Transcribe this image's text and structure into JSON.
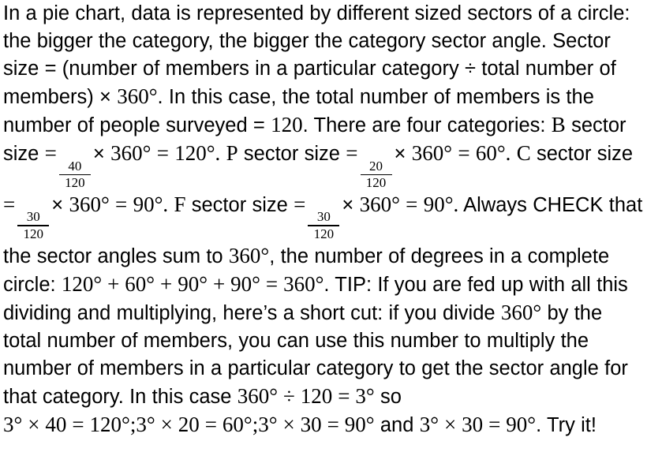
{
  "document": {
    "type": "textbook-explanation",
    "topic": "Pie chart sector size calculation",
    "body": {
      "s1": "In a pie chart, data is represented by different sized sectors of a circle: the bigger the category, the bigger the category sector angle. Sector size = (number of members in a particular category ÷ total number of members) × ",
      "deg360_a": "360°",
      "s2": ". In this case, the total number of members is the number of people surveyed = ",
      "n120_a": "120",
      "s3": ". There are four categories: ",
      "cat_b": "B",
      "s4": " sector size ",
      "eq1": "=",
      "frac1_num": "40",
      "frac1_den": "120",
      "times1": "×",
      "deg360_b": "360°",
      "eq2": "=",
      "deg120_a": "120°",
      "dot1": ".",
      "cat_p": "P",
      "s5": " sector size ",
      "eq3": "=",
      "frac2_num": "20",
      "frac2_den": "120",
      "times2": "×",
      "deg360_c": "360°",
      "eq4": "=",
      "deg60_a": "60°",
      "dot2": ".",
      "cat_c": "C",
      "s6": " sector size ",
      "eq5": "=",
      "frac3_num": "30",
      "frac3_den": "120",
      "times3": "×",
      "deg360_d": "360°",
      "eq6": "=",
      "deg90_a": "90°",
      "dot3": ".",
      "cat_f": "F",
      "s7": " sector size ",
      "eq7": "=",
      "frac4_num": "30",
      "frac4_den": "120",
      "times4": "×",
      "deg360_e": "360°",
      "eq8": "=",
      "deg90_b": "90°",
      "dot4": ".",
      "s8": " Always CHECK that the sector angles sum to ",
      "deg360_f": "360°",
      "s9": ", the number of degrees in a complete circle: ",
      "sum_expr": "120° + 60° + 90° + 90° = 360°",
      "s10": ". TIP: If you are fed up with all this dividing and multiplying, here’s a short cut: if you divide ",
      "deg360_g": "360°",
      "s11": " by the total number of members, you can use this number to multiply the number of members in a particular category to get the sector angle for that category. In this case ",
      "shortcut_1": "360° ÷ 120 = 3°",
      "s12": " so ",
      "shortcut_2": "3° × 40 = 120°;",
      "shortcut_3": "3° × 20 = 60°;",
      "shortcut_4": "3° × 30 = 90°",
      "s13": " and ",
      "shortcut_5": "3° × 30 = 90°",
      "s14": ". Try it!"
    }
  },
  "colors": {
    "text": "#000000",
    "background": "#ffffff"
  }
}
